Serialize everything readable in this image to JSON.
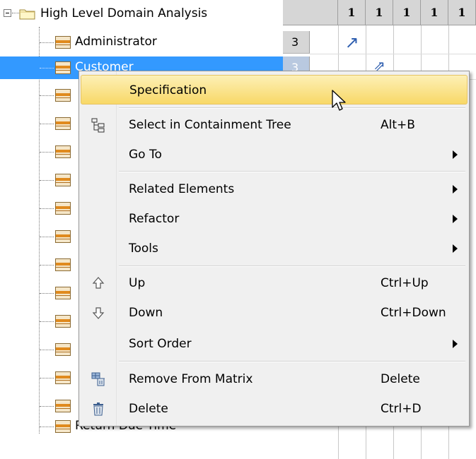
{
  "tree": {
    "root_label": "High Level Domain Analysis",
    "items": [
      {
        "label": "Administrator"
      },
      {
        "label": "Customer"
      },
      {
        "label": "Return Due Time"
      }
    ]
  },
  "matrix": {
    "column_headers": [
      "1",
      "1",
      "1",
      "1",
      "1"
    ],
    "row_headers": [
      "3",
      "3"
    ],
    "cells": [
      {
        "symbol": "↗"
      },
      {
        "symbol": "⇗"
      }
    ]
  },
  "context_menu": {
    "items": [
      {
        "label": "Specification",
        "shortcut": "",
        "icon": "",
        "submenu": false,
        "highlighted": true
      },
      {
        "label": "Select in Containment Tree",
        "shortcut": "Alt+B",
        "icon": "containment-tree-icon",
        "submenu": false
      },
      {
        "label": "Go To",
        "shortcut": "",
        "icon": "",
        "submenu": true
      },
      {
        "label": "Related Elements",
        "shortcut": "",
        "icon": "",
        "submenu": true
      },
      {
        "label": "Refactor",
        "shortcut": "",
        "icon": "",
        "submenu": true
      },
      {
        "label": "Tools",
        "shortcut": "",
        "icon": "",
        "submenu": true
      },
      {
        "label": "Up",
        "shortcut": "Ctrl+Up",
        "icon": "up-arrow-icon",
        "submenu": false
      },
      {
        "label": "Down",
        "shortcut": "Ctrl+Down",
        "icon": "down-arrow-icon",
        "submenu": false
      },
      {
        "label": "Sort Order",
        "shortcut": "",
        "icon": "",
        "submenu": true
      },
      {
        "label": "Remove From Matrix",
        "shortcut": "Delete",
        "icon": "remove-from-matrix-icon",
        "submenu": false
      },
      {
        "label": "Delete",
        "shortcut": "Ctrl+D",
        "icon": "trash-icon",
        "submenu": false
      }
    ]
  },
  "colors": {
    "selection": "#3399ff",
    "menu_background": "#f0f0f0",
    "menu_highlight": "#f8d867",
    "header_gray": "#d6d6d6"
  }
}
